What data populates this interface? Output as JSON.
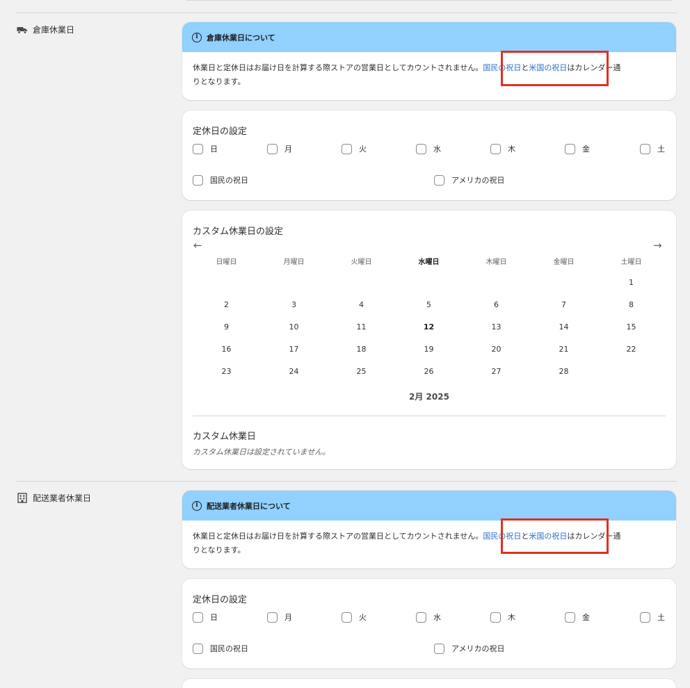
{
  "sections": [
    {
      "label": "倉庫休業日",
      "icon": "truck-icon",
      "banner": {
        "title": "倉庫休業日について",
        "text_before": "休業日と定休日はお届け日を計算する際ストアの営業日としてカウントされません。",
        "link1": "国民の祝日",
        "and": "と",
        "link2": "米国の祝日",
        "text_after": "はカレンダー通",
        "text_line2": "りとなります。"
      },
      "weekly": {
        "title": "定休日の設定",
        "days": [
          "日",
          "月",
          "火",
          "水",
          "木",
          "金",
          "土"
        ],
        "holidays": [
          "国民の祝日",
          "アメリカの祝日"
        ]
      },
      "custom": {
        "title": "カスタム休業日の設定",
        "prev_arrow": "←",
        "next_arrow": "→",
        "weekdays": [
          "日曜日",
          "月曜日",
          "火曜日",
          "水曜日",
          "木曜日",
          "金曜日",
          "土曜日"
        ],
        "weeks": [
          [
            "",
            "",
            "",
            "",
            "",
            "",
            "1"
          ],
          [
            "2",
            "3",
            "4",
            "5",
            "6",
            "7",
            "8"
          ],
          [
            "9",
            "10",
            "11",
            "12",
            "13",
            "14",
            "15"
          ],
          [
            "16",
            "17",
            "18",
            "19",
            "20",
            "21",
            "22"
          ],
          [
            "23",
            "24",
            "25",
            "26",
            "27",
            "28",
            ""
          ]
        ],
        "today": "12",
        "today_weekday": "水曜日",
        "month_label": "2月 2025",
        "list_title": "カスタム休業日",
        "empty_note": "カスタム休業日は設定されていません。"
      }
    },
    {
      "label": "配送業者休業日",
      "icon": "building-icon",
      "banner": {
        "title": "配送業者休業日について",
        "text_before": "休業日と定休日はお届け日を計算する際ストアの営業日としてカウントされません。",
        "link1": "国民の祝日",
        "and": "と",
        "link2": "米国の祝日",
        "text_after": "はカレンダー通",
        "text_line2": "りとなります。"
      },
      "weekly": {
        "title": "定休日の設定",
        "days": [
          "日",
          "月",
          "火",
          "水",
          "木",
          "金",
          "土"
        ],
        "holidays": [
          "国民の祝日",
          "アメリカの祝日"
        ]
      }
    }
  ],
  "colors": {
    "banner_bg": "#91d0ff",
    "link": "#2c6ecb",
    "highlight_box": "#e0301e",
    "page_bg": "#f1f1f1"
  }
}
